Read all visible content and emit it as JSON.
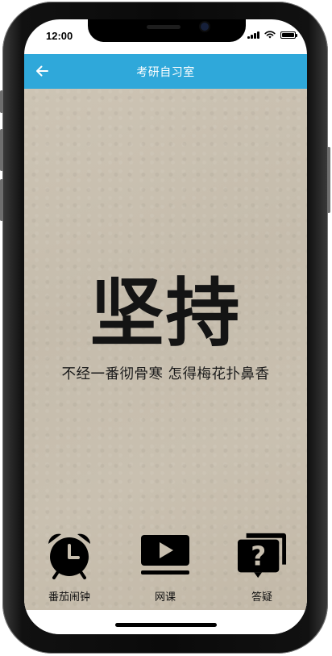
{
  "status_bar": {
    "time": "12:00"
  },
  "header": {
    "back_icon": "arrow-left-icon",
    "title": "考研自习室",
    "color": "#2fa8da"
  },
  "motto": {
    "main": "坚持",
    "sub": "不经一番彻骨寒 怎得梅花扑鼻香"
  },
  "functions": [
    {
      "label": "番茄闹钟",
      "icon": "alarm-clock-icon"
    },
    {
      "label": "网课",
      "icon": "video-play-icon"
    },
    {
      "label": "答疑",
      "icon": "question-cards-icon"
    }
  ]
}
